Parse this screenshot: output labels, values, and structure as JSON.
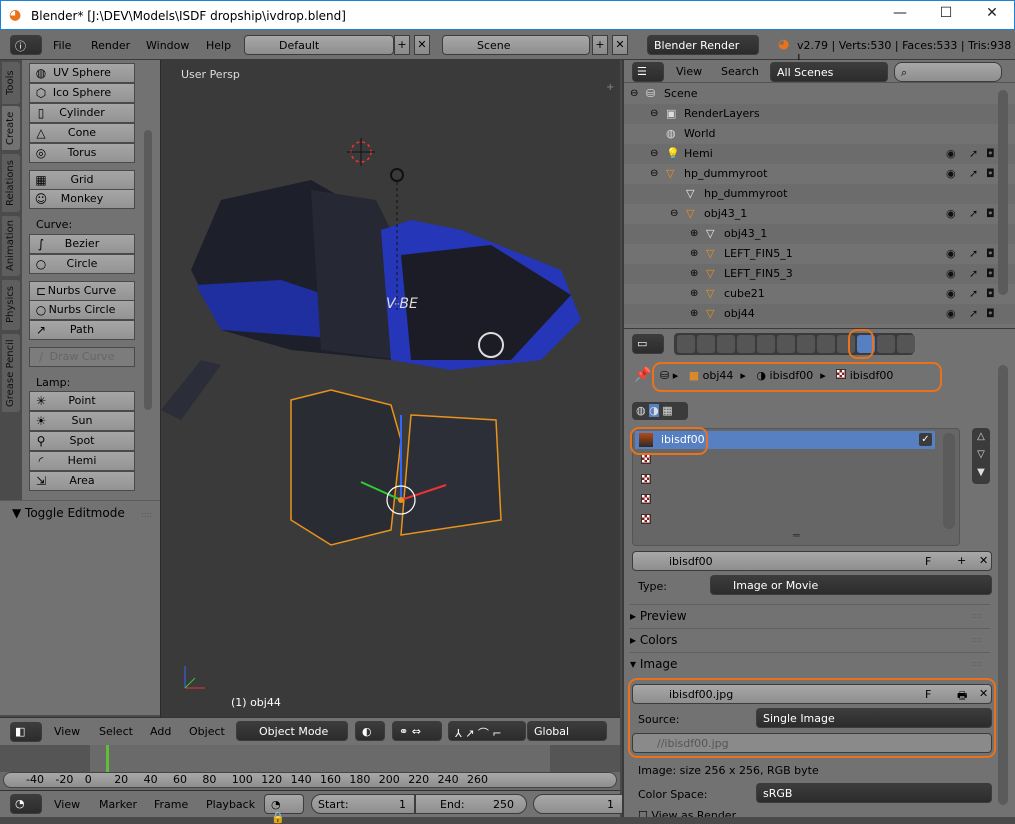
{
  "window": {
    "title": "Blender* [J:\\DEV\\Models\\ISDF dropship\\ivdrop.blend]",
    "minimize": "—",
    "maximize": "☐",
    "close": "✕"
  },
  "topbar": {
    "menus": [
      "File",
      "Render",
      "Window",
      "Help"
    ],
    "layout": "Default",
    "scene": "Scene",
    "engine": "Blender Render",
    "stats": "v2.79 | Verts:530 | Faces:533 | Tris:938 |"
  },
  "toolshelf": {
    "tabs": [
      "Tools",
      "Create",
      "Relations",
      "Animation",
      "Physics",
      "Grease Pencil"
    ],
    "active_tab": "Create",
    "mesh": [
      {
        "label": "UV Sphere",
        "icon": "◍"
      },
      {
        "label": "Ico Sphere",
        "icon": "⬡"
      },
      {
        "label": "Cylinder",
        "icon": "▯"
      },
      {
        "label": "Cone",
        "icon": "△"
      },
      {
        "label": "Torus",
        "icon": "◎"
      }
    ],
    "mesh2": [
      {
        "label": "Grid",
        "icon": "▦"
      },
      {
        "label": "Monkey",
        "icon": "☺"
      }
    ],
    "curve_label": "Curve:",
    "curve": [
      {
        "label": "Bezier",
        "icon": "∫"
      },
      {
        "label": "Circle",
        "icon": "○"
      }
    ],
    "curve2": [
      {
        "label": "Nurbs Curve",
        "icon": "⊏"
      },
      {
        "label": "Nurbs Circle",
        "icon": "○"
      },
      {
        "label": "Path",
        "icon": "↗"
      }
    ],
    "draw_curve": "Draw Curve",
    "lamp_label": "Lamp:",
    "lamp": [
      {
        "label": "Point",
        "icon": "✳"
      },
      {
        "label": "Sun",
        "icon": "☀"
      },
      {
        "label": "Spot",
        "icon": "⚲"
      },
      {
        "label": "Hemi",
        "icon": "◜"
      },
      {
        "label": "Area",
        "icon": "⇲"
      }
    ],
    "toggle_editmode": "Toggle Editmode"
  },
  "viewport": {
    "label": "User Persp",
    "object": "(1) obj44",
    "decal": "V-BE"
  },
  "viewport_header": {
    "menus": [
      "View",
      "Select",
      "Add",
      "Object"
    ],
    "mode": "Object Mode",
    "orientation": "Global"
  },
  "timeline": {
    "ticks": [
      "-40",
      "-20",
      "0",
      "20",
      "40",
      "60",
      "80",
      "100",
      "120",
      "140",
      "160",
      "180",
      "200",
      "220",
      "240",
      "260"
    ],
    "current_frame": 0,
    "menus": [
      "View",
      "Marker",
      "Frame",
      "Playback"
    ],
    "start_label": "Start:",
    "start": "1",
    "end_label": "End:",
    "end": "250",
    "current": "1"
  },
  "outliner": {
    "menus": [
      "View",
      "Search"
    ],
    "filter": "All Scenes",
    "rows": [
      {
        "label": "Scene",
        "indent": 0,
        "icon": "scene",
        "extra": ""
      },
      {
        "label": "RenderLayers",
        "indent": 1,
        "icon": "renderlayers",
        "extra": "|"
      },
      {
        "label": "World",
        "indent": 1,
        "icon": "world",
        "extra": ""
      },
      {
        "label": "Hemi",
        "indent": 1,
        "icon": "lamp",
        "extra": "|",
        "vis": true
      },
      {
        "label": "hp_dummyroot",
        "indent": 1,
        "icon": "object",
        "extra": "",
        "vis": true
      },
      {
        "label": "hp_dummyroot",
        "indent": 2,
        "icon": "mesh",
        "extra": ""
      },
      {
        "label": "obj43_1",
        "indent": 2,
        "icon": "object",
        "extra": "",
        "vis": true
      },
      {
        "label": "obj43_1",
        "indent": 3,
        "icon": "mesh",
        "extra": "|"
      },
      {
        "label": "LEFT_FIN5_1",
        "indent": 3,
        "icon": "object",
        "extra": "|",
        "vis": true
      },
      {
        "label": "LEFT_FIN5_3",
        "indent": 3,
        "icon": "object",
        "extra": "|",
        "vis": true
      },
      {
        "label": "cube21",
        "indent": 3,
        "icon": "object",
        "extra": "|",
        "vis": true
      },
      {
        "label": "obj44",
        "indent": 3,
        "icon": "object",
        "extra": "|",
        "vis": true
      }
    ]
  },
  "properties": {
    "breadcrumb": [
      "obj44",
      "ibisdf00",
      "ibisdf00"
    ],
    "texture_slots": {
      "active": "ibisdf00",
      "empty_count": 4
    },
    "texture_name": "ibisdf00",
    "fake_user": "F",
    "type_label": "Type:",
    "type": "Image or Movie",
    "panels": {
      "preview": "Preview",
      "colors": "Colors",
      "image": "Image"
    },
    "image_name": "ibisdf00.jpg",
    "source_label": "Source:",
    "source": "Single Image",
    "filepath": "//ibisdf00.jpg",
    "image_info": "Image: size 256 x 256, RGB byte",
    "colorspace_label": "Color Space:",
    "colorspace": "sRGB",
    "view_as_render": "View as Render"
  },
  "colors": {
    "highlight": "#e8731c",
    "selection": "#5680c2",
    "frame_cursor": "#5fbf3a"
  }
}
